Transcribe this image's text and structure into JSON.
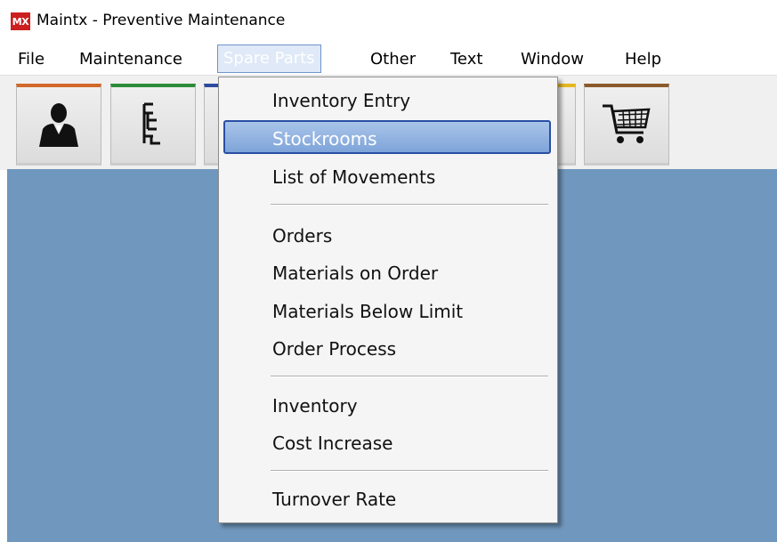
{
  "app": {
    "logo_text": "MX",
    "title": "Maintx - Preventive Maintenance"
  },
  "menubar": {
    "items": [
      "File",
      "Maintenance",
      "Spare Parts",
      "Other",
      "Text",
      "Window",
      "Help"
    ],
    "active": "Spare Parts"
  },
  "toolbar": {
    "buttons": [
      {
        "icon": "user-icon",
        "accent": "#d2692a"
      },
      {
        "icon": "tree-structure-icon",
        "accent": "#2e8b3a"
      },
      {
        "icon": "unknown-icon",
        "accent": "#2c4aa0"
      },
      {
        "icon": "unknown-icon",
        "accent": "#e6b820"
      },
      {
        "icon": "shopping-cart-icon",
        "accent": "#8b5a2b"
      }
    ]
  },
  "spare_parts_menu": {
    "items": [
      "Inventory Entry",
      "Stockrooms",
      "List of Movements",
      "Orders",
      "Materials on Order",
      "Materials Below Limit",
      "Order Process",
      "Inventory",
      "Cost Increase",
      "Turnover Rate"
    ],
    "highlighted": "Stockrooms"
  },
  "colors": {
    "desktop_bg": "#7097bd",
    "highlight": "#7ea4d9"
  }
}
